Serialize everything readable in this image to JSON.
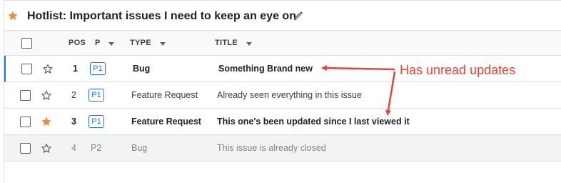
{
  "hotlist": {
    "title": "Hotlist: Important issues I need to keep an eye on"
  },
  "columns": {
    "pos": "POS",
    "pri": "P",
    "type": "TYPE",
    "title": "TITLE"
  },
  "rows": [
    {
      "pos": "1",
      "pri": "P1",
      "type": "Bug",
      "title": "Something Brand new",
      "starred": false,
      "unread": true,
      "closed": false
    },
    {
      "pos": "2",
      "pri": "P1",
      "type": "Feature Request",
      "title": "Already seen everything in this issue",
      "starred": false,
      "unread": false,
      "closed": false
    },
    {
      "pos": "3",
      "pri": "P1",
      "type": "Feature Request",
      "title": "This one's been updated since I last viewed it",
      "starred": true,
      "unread": true,
      "closed": false
    },
    {
      "pos": "4",
      "pri": "P2",
      "type": "Bug",
      "title": "This issue is already closed",
      "starred": false,
      "unread": false,
      "closed": true
    }
  ],
  "annotation": {
    "text": "Has unread updates",
    "color": "#ea4335"
  },
  "colors": {
    "accent_blue": "#1a73e8",
    "star_orange": "#f28b34"
  },
  "icons": {
    "title_star": "star-filled-icon",
    "edit": "pencil-icon",
    "row_star_empty": "star-outline-icon",
    "row_star_filled": "star-filled-icon"
  }
}
